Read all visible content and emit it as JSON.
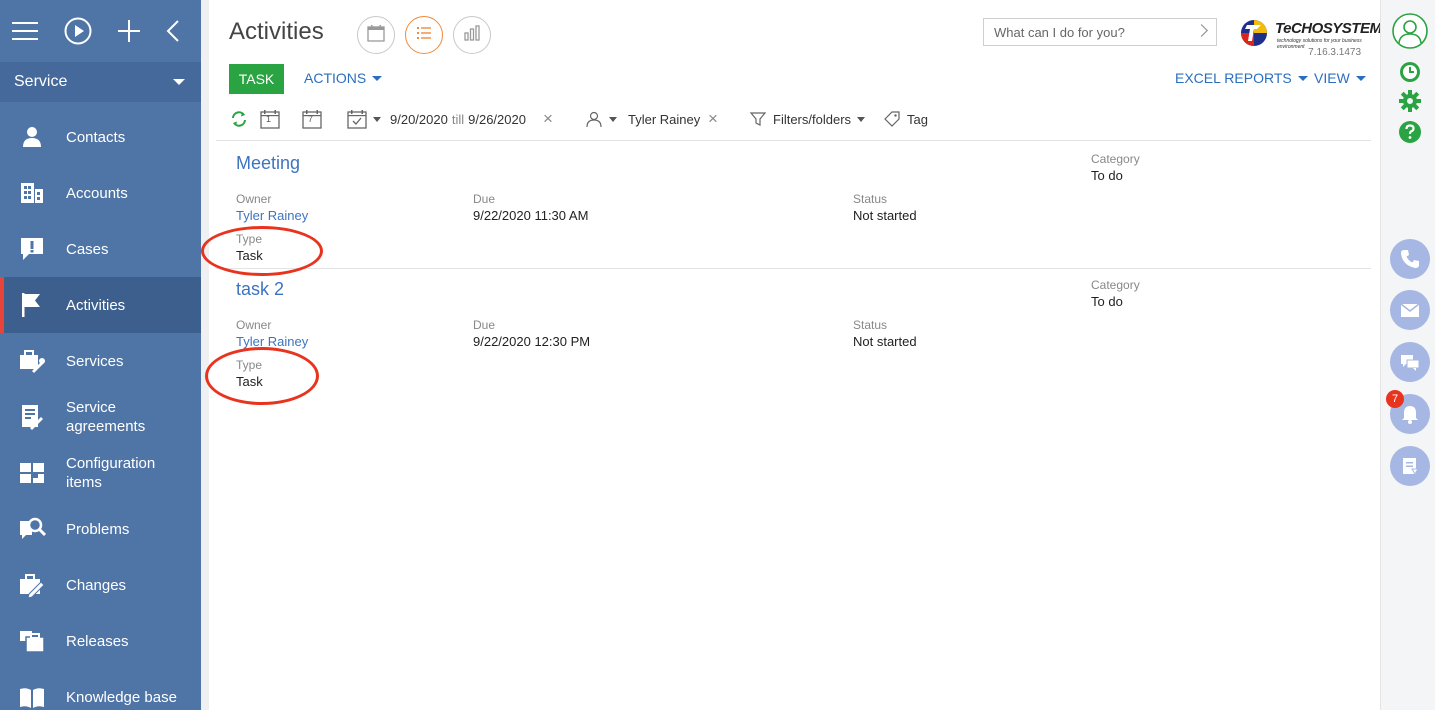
{
  "sidebar": {
    "section": "Service",
    "items": [
      {
        "label": "Contacts",
        "icon": "person-icon"
      },
      {
        "label": "Accounts",
        "icon": "building-icon"
      },
      {
        "label": "Cases",
        "icon": "exclamation-bubble-icon"
      },
      {
        "label": "Activities",
        "icon": "flag-icon"
      },
      {
        "label": "Services",
        "icon": "briefcase-wrench-icon"
      },
      {
        "label": "Service agreements",
        "icon": "document-wrench-icon"
      },
      {
        "label": "Configuration items",
        "icon": "blocks-icon"
      },
      {
        "label": "Problems",
        "icon": "magnifier-document-icon"
      },
      {
        "label": "Changes",
        "icon": "briefcase-pencil-icon"
      },
      {
        "label": "Releases",
        "icon": "stacked-briefcase-icon"
      },
      {
        "label": "Knowledge base",
        "icon": "book-icon"
      }
    ]
  },
  "header": {
    "title": "Activities",
    "search_placeholder": "What can I do for you?",
    "logo_text": "TeCHOSYSTEMS",
    "logo_tagline": "technology solutions for your business environment",
    "version": "7.16.3.1473"
  },
  "toolbar": {
    "task_label": "TASK",
    "actions_label": "ACTIONS",
    "excel_label": "EXCEL REPORTS",
    "view_label": "VIEW"
  },
  "filters": {
    "day_number": "1",
    "week_number": "7",
    "date_from": "9/20/2020",
    "till_label": "till",
    "date_to": "9/26/2020",
    "owner": "Tyler Rainey",
    "folders_label": "Filters/folders",
    "tag_label": "Tag"
  },
  "records": [
    {
      "title": "Meeting",
      "owner_caption": "Owner",
      "owner": "Tyler Rainey",
      "due_caption": "Due",
      "due": "9/22/2020 11:30 AM",
      "status_caption": "Status",
      "status": "Not started",
      "category_caption": "Category",
      "category": "To do",
      "type_caption": "Type",
      "type": "Task"
    },
    {
      "title": "task 2",
      "owner_caption": "Owner",
      "owner": "Tyler Rainey",
      "due_caption": "Due",
      "due": "9/22/2020 12:30 PM",
      "status_caption": "Status",
      "status": "Not started",
      "category_caption": "Category",
      "category": "To do",
      "type_caption": "Type",
      "type": "Task"
    }
  ],
  "rail": {
    "notification_count": "7"
  },
  "colors": {
    "sidebar": "#4f74a6",
    "active_item": "#3d5f8e",
    "accent_green": "#2aa342",
    "link_blue": "#3d74c0",
    "annotation_red": "#e8341f"
  }
}
